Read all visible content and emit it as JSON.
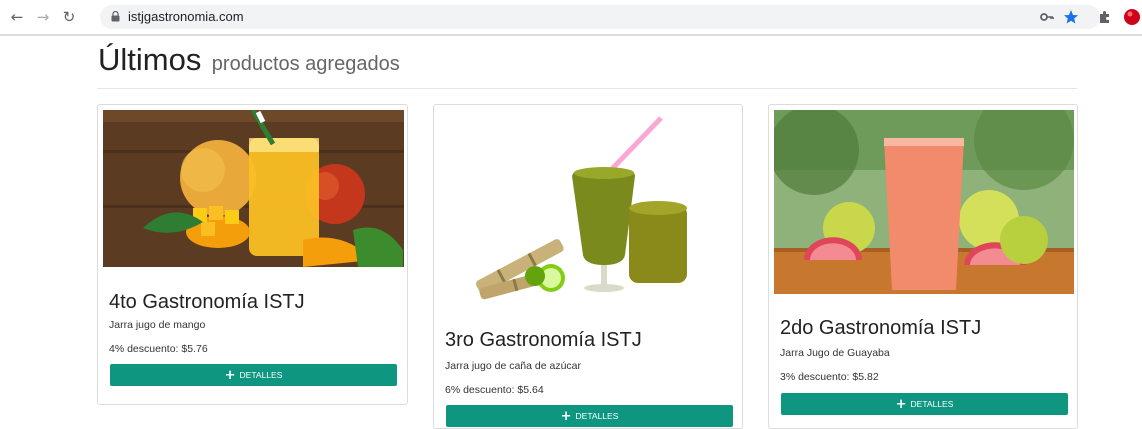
{
  "browser": {
    "url": "istjgastronomia.com",
    "icons": [
      "back-icon",
      "forward-icon",
      "reload-icon",
      "lock-icon",
      "key-icon",
      "star-icon",
      "extensions-icon",
      "profile-icon"
    ]
  },
  "section": {
    "title_main": "Últimos",
    "title_sub": "productos agregados"
  },
  "products": [
    {
      "title": "4to Gastronomía ISTJ",
      "description": "Jarra jugo de mango",
      "discount": "4% descuento: $5.76",
      "button_label": "DETALLES",
      "button_icon": "plus-icon"
    },
    {
      "title": "3ro Gastronomía ISTJ",
      "description": "Jarra jugo de caña de azúcar",
      "discount": "6% descuento: $5.64",
      "button_label": "DETALLES",
      "button_icon": "plus-icon"
    },
    {
      "title": "2do Gastronomía ISTJ",
      "description": "Jarra Jugo de Guayaba",
      "discount": "3% descuento: $5.82",
      "button_label": "DETALLES",
      "button_icon": "plus-icon"
    }
  ],
  "colors": {
    "button": "#0e9680",
    "star": "#1a73e8"
  }
}
